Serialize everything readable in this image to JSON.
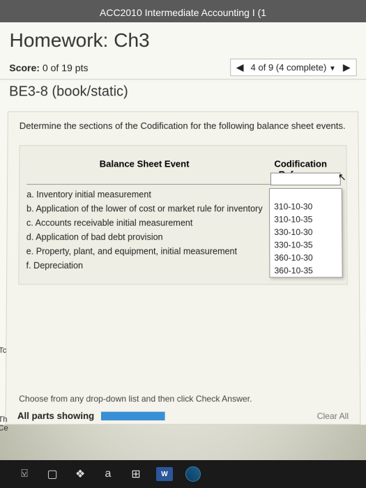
{
  "course_title": "ACC2010 Intermediate Accounting I (1",
  "homework_title": "Homework: Ch3",
  "score": {
    "label": "Score:",
    "value": "0 of 19 pts"
  },
  "nav": {
    "position": "4 of 9 (4 complete)"
  },
  "problem_id": "BE3-8 (book/static)",
  "instruction": "Determine the sections of the Codification for the following balance sheet events.",
  "table": {
    "col1": "Balance Sheet Event",
    "col2a": "Codification",
    "col2b": "Reference",
    "events": [
      "a. Inventory initial measurement",
      "b. Application of the lower of cost or market rule for inventory",
      "c. Accounts receivable initial measurement",
      "d. Application of bad debt provision",
      "e. Property, plant, and equipment, initial measurement",
      "f. Depreciation"
    ]
  },
  "dropdown": {
    "options": [
      "",
      "310-10-30",
      "310-10-35",
      "330-10-30",
      "330-10-35",
      "360-10-30",
      "360-10-35"
    ]
  },
  "hint": "Choose from any drop-down list and then click Check Answer.",
  "footer": {
    "parts": "All parts showing",
    "clear": "Clear All"
  },
  "edge": {
    "tc": "Tc",
    "th": "Th",
    "ce": "Ce"
  },
  "taskbar": {
    "a": "a"
  }
}
